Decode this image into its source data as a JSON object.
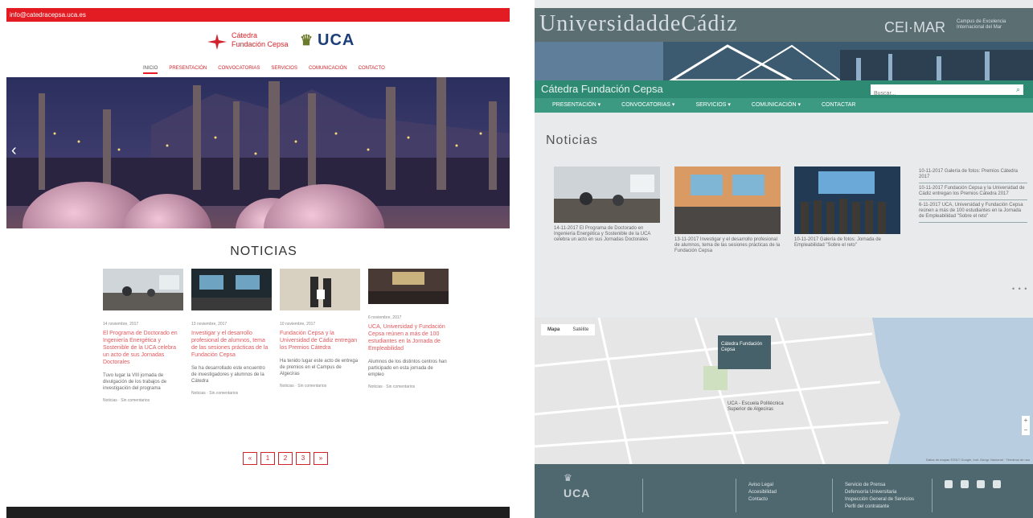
{
  "left": {
    "topbar_email": "info@catedracepsa.uca.es",
    "logo": {
      "cepsa_text_line1": "Cátedra",
      "cepsa_text_line2": "Fundación Cepsa",
      "uca_text": "UCA"
    },
    "nav": [
      "INICIO",
      "PRESENTACIÓN",
      "CONVOCATORIAS",
      "SERVICIOS",
      "COMUNICACIÓN",
      "CONTACTO"
    ],
    "section_title": "NOTICIAS",
    "cards": [
      {
        "date": "14 noviembre, 2017",
        "title": "El Programa de Doctorado en Ingeniería Energética y Sostenible de la UCA celebra un acto de sus Jornadas Doctorales",
        "excerpt": "Tuvo lugar la VIII jornada de divulgación de los trabajos de investigación del programa",
        "meta_cat": "Noticias",
        "meta_comments": "Sin comentarios"
      },
      {
        "date": "13 noviembre, 2017",
        "title": "Investigar y el desarrollo profesional de alumnos, tema de las sesiones prácticas de la Fundación Cepsa",
        "excerpt": "Se ha desarrollado este encuentro de investigadores y alumnos de la Cátedra",
        "meta_cat": "Noticias",
        "meta_comments": "Sin comentarios"
      },
      {
        "date": "10 noviembre, 2017",
        "title": "Fundación Cepsa y la Universidad de Cádiz entregan los Premios Cátedra",
        "excerpt": "Ha tenido lugar este acto de entrega de premios en el Campus de Algeciras",
        "meta_cat": "Noticias",
        "meta_comments": "Sin comentarios"
      },
      {
        "date": "6 noviembre, 2017",
        "title": "UCA, Universidad y Fundación Cepsa reúnen a más de 100 estudiantes en la Jornada de Empleabilidad",
        "excerpt": "Alumnos de los distintos centros han participado en esta jornada de empleo",
        "meta_cat": "Noticias",
        "meta_comments": "Sin comentarios"
      }
    ],
    "pager": [
      "«",
      "1",
      "2",
      "3",
      "»"
    ]
  },
  "right": {
    "header_title": "UniversidaddeCádiz",
    "ceimar": "CEI·MAR",
    "ceimar_sub": "Campus de Excelencia Internacional del Mar",
    "catedra_name": "Cátedra Fundación Cepsa",
    "search_placeholder": "Buscar...",
    "nav": [
      "PRESENTACIÓN ▾",
      "CONVOCATORIAS ▾",
      "SERVICIOS ▾",
      "COMUNICACIÓN ▾",
      "CONTACTAR"
    ],
    "section_title": "Noticias",
    "cards": [
      {
        "caption": "14-11-2017 El Programa de Doctorado en Ingeniería Energética y Sostenible de la UCA celebra un acto en sus Jornadas Doctorales"
      },
      {
        "caption": "13-11-2017 Investigar y el desarrollo profesional de alumnos, tema de las sesiones prácticas de la Fundación Cepsa"
      },
      {
        "caption": "10-11-2017 Galería de fotos: Jornada de Empleabilidad \"Sobre el reto\""
      }
    ],
    "side_entries": [
      "10-11-2017 Galería de fotos: Premios Cátedra 2017",
      "10-11-2017 Fundación Cepsa y la Universidad de Cádiz entregan los Premios Cátedra 2017",
      "6-11-2017 UCA, Universidad y Fundación Cepsa reúnen a más de 100 estudiantes en la Jornada de Empleabilidad \"Sobre el reto\""
    ],
    "more": "• • •",
    "map": {
      "tab_map": "Mapa",
      "tab_sat": "Satélite",
      "pin_text": "Cátedra Fundación Cepsa",
      "place_label": "UCA - Escuela Politécnica Superior de Algeciras",
      "credit": "Datos de mapas ©2017 Google, Inst. Geogr. Nacional · Términos de uso",
      "zoom_in": "+",
      "zoom_out": "−"
    },
    "footer": {
      "uca": "UCA",
      "links_col1": [
        "Aviso Legal",
        "Accesibilidad",
        "Contacto"
      ],
      "links_col2": [
        "Servicio de Prensa",
        "Defensoría Universitaria",
        "Inspección General de Servicios",
        "Perfil del contratante"
      ]
    }
  }
}
